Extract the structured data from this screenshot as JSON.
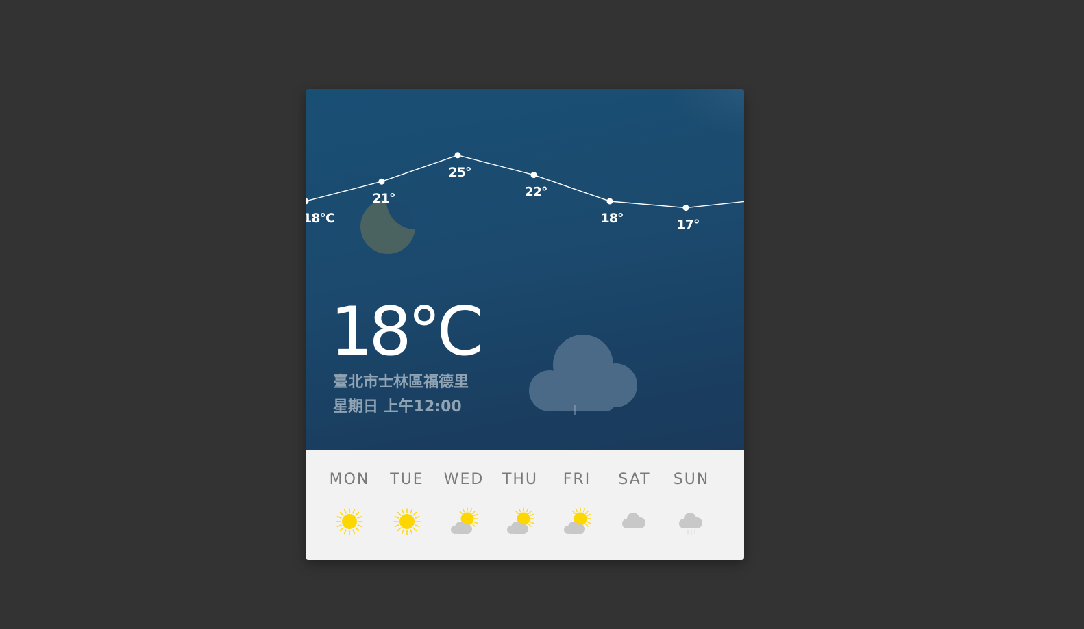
{
  "current": {
    "temperature": "18°C",
    "location": "臺北市士林區福德里",
    "datetime": "星期日 上午12:00",
    "condition_icon": "cloud-icon",
    "night_icon": "moon-icon"
  },
  "chart_data": {
    "type": "line",
    "series": [
      {
        "values": [
          18,
          21,
          25,
          22,
          18,
          17
        ],
        "labels": [
          "18°C",
          "21°",
          "25°",
          "22°",
          "18°",
          "17°"
        ]
      }
    ]
  },
  "forecast": [
    {
      "day": "MON",
      "icon": "sun-icon"
    },
    {
      "day": "TUE",
      "icon": "sun-icon"
    },
    {
      "day": "WED",
      "icon": "partly-cloudy-icon"
    },
    {
      "day": "THU",
      "icon": "partly-cloudy-icon"
    },
    {
      "day": "FRI",
      "icon": "partly-cloudy-icon"
    },
    {
      "day": "SAT",
      "icon": "cloud-icon"
    },
    {
      "day": "SUN",
      "icon": "rain-icon"
    }
  ],
  "colors": {
    "sky": "#1b4a6e",
    "sun": "#ffd700",
    "cloud": "#c8c8c8",
    "text_muted": "#8fa3b3",
    "forecast_bg": "#f2f2f2"
  }
}
